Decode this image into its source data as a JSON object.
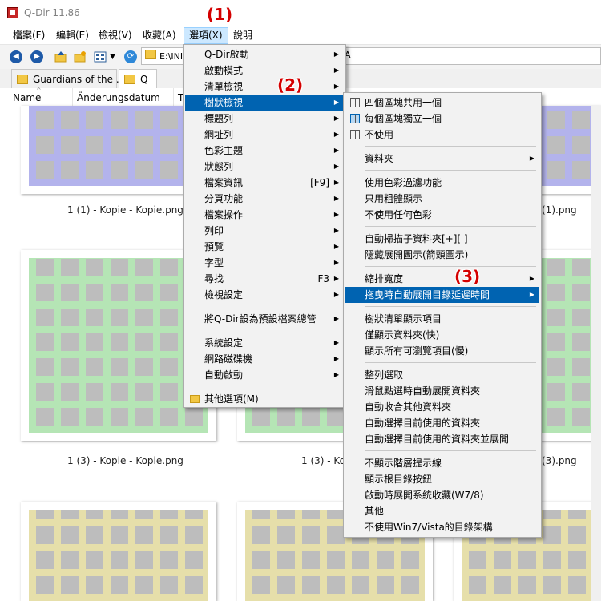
{
  "window": {
    "title": "Q-Dir 11.86"
  },
  "menubar": [
    {
      "label": "檔案(F)",
      "active": false
    },
    {
      "label": "編輯(E)",
      "active": false
    },
    {
      "label": "檢視(V)",
      "active": false
    },
    {
      "label": "收藏(A)",
      "active": false
    },
    {
      "label": "選項(X)",
      "active": true
    },
    {
      "label": "說明",
      "active": false
    }
  ],
  "address": {
    "value": "E:\\INI",
    "trailing": "A"
  },
  "tabs": [
    {
      "label": "Guardians of the ...",
      "active": false
    },
    {
      "label": "Q",
      "active": true
    }
  ],
  "columns": {
    "name": "Name",
    "date": "Änderungsdatum",
    "type": "T"
  },
  "files": [
    {
      "label": "1 (1) - Kopie - Kopie.png"
    },
    {
      "label": "(1).png"
    },
    {
      "label": "1 (3) - Kopie - Kopie.png"
    },
    {
      "label": "1 (3) - Kopie -"
    },
    {
      "label": "(3).png"
    }
  ],
  "badges": [
    "(1)",
    "(2)",
    "(3)"
  ],
  "options_menu": {
    "items": [
      {
        "label": "Q-Dir啟動",
        "submenu": true
      },
      {
        "label": "啟動模式",
        "submenu": true
      },
      {
        "label": "清單檢視",
        "submenu": true
      },
      {
        "label": "樹狀檢視",
        "submenu": true,
        "highlight": true
      },
      {
        "label": "標題列",
        "submenu": true
      },
      {
        "label": "網址列",
        "submenu": true
      },
      {
        "label": "色彩主題",
        "submenu": true
      },
      {
        "label": "狀態列",
        "submenu": true
      },
      {
        "label": "檔案資訊",
        "shortcut": "[F9]",
        "submenu": true
      },
      {
        "label": "分頁功能",
        "submenu": true
      },
      {
        "label": "檔案操作",
        "submenu": true
      },
      {
        "label": "列印",
        "submenu": true
      },
      {
        "label": "預覽",
        "submenu": true
      },
      {
        "label": "字型",
        "submenu": true
      },
      {
        "label": "尋找",
        "shortcut": "F3",
        "submenu": true
      },
      {
        "label": "檢視設定",
        "submenu": true
      },
      {
        "label": "將Q-Dir設為預設檔案總管",
        "submenu": true
      },
      {
        "label": "系統設定",
        "submenu": true
      },
      {
        "label": "網路磁碟機",
        "submenu": true
      },
      {
        "label": "自動啟動",
        "submenu": true
      },
      {
        "label": "其他選項(M)",
        "submenu": false
      }
    ]
  },
  "tree_menu": {
    "items": [
      {
        "label": "四個區塊共用一個",
        "icon": "grid"
      },
      {
        "label": "每個區塊獨立一個",
        "icon": "grid-selected"
      },
      {
        "label": "不使用",
        "icon": "grid"
      },
      {
        "label": "資料夾",
        "submenu": true
      },
      {
        "label": "使用色彩過濾功能"
      },
      {
        "label": "只用粗體顯示"
      },
      {
        "label": "不使用任何色彩"
      },
      {
        "label": "自動掃描子資料夾[+][ ]"
      },
      {
        "label": "隱藏展開圖示(箭頭圖示)"
      },
      {
        "label": "縮排寬度",
        "submenu": true
      },
      {
        "label": "拖曳時自動展開目錄延遲時間",
        "submenu": true,
        "highlight": true
      },
      {
        "label": "樹狀清單顯示項目"
      },
      {
        "label": "僅顯示資料夾(快)"
      },
      {
        "label": "顯示所有可瀏覽項目(慢)"
      },
      {
        "label": "整列選取"
      },
      {
        "label": "滑鼠點選時自動展開資料夾"
      },
      {
        "label": "自動收合其他資料夾"
      },
      {
        "label": "自動選擇目前使用的資料夾"
      },
      {
        "label": "自動選擇目前使用的資料夾並展開"
      },
      {
        "label": "不顯示階層提示線"
      },
      {
        "label": "顯示根目錄按鈕"
      },
      {
        "label": "啟動時展開系統收藏(W7/8)"
      },
      {
        "label": "其他"
      },
      {
        "label": "不使用Win7/Vista的目錄架構"
      }
    ]
  },
  "colors": {
    "highlight": "#0063b1",
    "purple_tile": "#b3b3ec",
    "green_tile": "#b5e5b5",
    "yellow_tile": "#e6dfaa",
    "badge": "#d40000"
  }
}
